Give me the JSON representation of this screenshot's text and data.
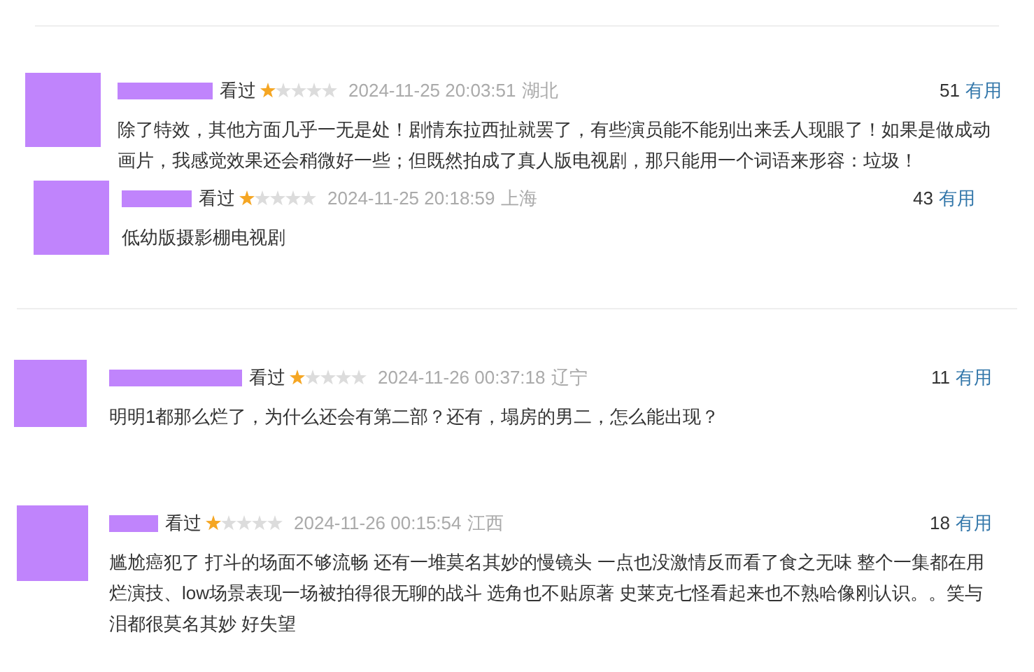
{
  "reviews": [
    {
      "status": "看过",
      "stars": 1,
      "time": "2024-11-25 20:03:51",
      "location": "湖北",
      "votes": "51",
      "vote_label": "有用",
      "text": "除了特效，其他方面几乎一无是处！剧情东拉西扯就罢了，有些演员能不能别出来丢人现眼了！如果是做成动画片，我感觉效果还会稍微好一些；但既然拍成了真人版电视剧，那只能用一个词语来形容：垃圾！"
    },
    {
      "status": "看过",
      "stars": 1,
      "time": "2024-11-25 20:18:59",
      "location": "上海",
      "votes": "43",
      "vote_label": "有用",
      "text": "低幼版摄影棚电视剧"
    },
    {
      "status": "看过",
      "stars": 1,
      "time": "2024-11-26 00:37:18",
      "location": "辽宁",
      "votes": "11",
      "vote_label": "有用",
      "text": "明明1都那么烂了，为什么还会有第二部？还有，塌房的男二，怎么能出现？"
    },
    {
      "status": "看过",
      "stars": 1,
      "time": "2024-11-26 00:15:54",
      "location": "江西",
      "votes": "18",
      "vote_label": "有用",
      "text": "尴尬癌犯了 打斗的场面不够流畅 还有一堆莫名其妙的慢镜头 一点也没激情反而看了食之无味 整个一集都在用烂演技、low场景表现一场被拍得很无聊的战斗 选角也不贴原著 史莱克七怪看起来也不熟哈像刚认识。。笑与泪都很莫名其妙 好失望"
    }
  ]
}
